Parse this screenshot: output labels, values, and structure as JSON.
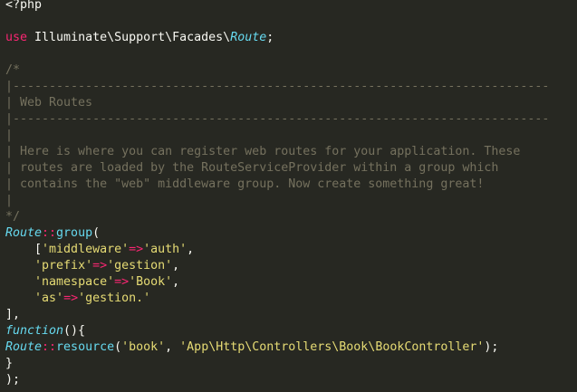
{
  "colors": {
    "background": "#272822",
    "plain": "#f8f8f2",
    "keyword": "#f92672",
    "class": "#66d9ef",
    "string": "#e6db74",
    "comment": "#75715e"
  },
  "code": {
    "lines": [
      [
        {
          "t": "<?php",
          "k": "plain"
        }
      ],
      [],
      [
        {
          "t": "use",
          "k": "keyword"
        },
        {
          "t": " Illuminate\\Support\\Facades\\",
          "k": "plain"
        },
        {
          "t": "Route",
          "k": "class"
        },
        {
          "t": ";",
          "k": "plain"
        }
      ],
      [],
      [
        {
          "t": "/*",
          "k": "comment"
        }
      ],
      [
        {
          "t": "|--------------------------------------------------------------------------",
          "k": "comment"
        }
      ],
      [
        {
          "t": "| Web Routes",
          "k": "comment"
        }
      ],
      [
        {
          "t": "|--------------------------------------------------------------------------",
          "k": "comment"
        }
      ],
      [
        {
          "t": "|",
          "k": "comment"
        }
      ],
      [
        {
          "t": "| Here is where you can register web routes for your application. These",
          "k": "comment"
        }
      ],
      [
        {
          "t": "| routes are loaded by the RouteServiceProvider within a group which",
          "k": "comment"
        }
      ],
      [
        {
          "t": "| contains the \"web\" middleware group. Now create something great!",
          "k": "comment"
        }
      ],
      [
        {
          "t": "|",
          "k": "comment"
        }
      ],
      [
        {
          "t": "*/",
          "k": "comment"
        }
      ],
      [
        {
          "t": "Route",
          "k": "class"
        },
        {
          "t": "::",
          "k": "op"
        },
        {
          "t": "group",
          "k": "method"
        },
        {
          "t": "(",
          "k": "plain"
        }
      ],
      [
        {
          "t": "    [",
          "k": "plain"
        },
        {
          "t": "'middleware'",
          "k": "string"
        },
        {
          "t": "=>",
          "k": "op"
        },
        {
          "t": "'auth'",
          "k": "string"
        },
        {
          "t": ",",
          "k": "plain"
        }
      ],
      [
        {
          "t": "    ",
          "k": "plain"
        },
        {
          "t": "'prefix'",
          "k": "string"
        },
        {
          "t": "=>",
          "k": "op"
        },
        {
          "t": "'gestion'",
          "k": "string"
        },
        {
          "t": ",",
          "k": "plain"
        }
      ],
      [
        {
          "t": "    ",
          "k": "plain"
        },
        {
          "t": "'namespace'",
          "k": "string"
        },
        {
          "t": "=>",
          "k": "op"
        },
        {
          "t": "'Book'",
          "k": "string"
        },
        {
          "t": ",",
          "k": "plain"
        }
      ],
      [
        {
          "t": "    ",
          "k": "plain"
        },
        {
          "t": "'as'",
          "k": "string"
        },
        {
          "t": "=>",
          "k": "op"
        },
        {
          "t": "'gestion.'",
          "k": "string"
        }
      ],
      [
        {
          "t": "],",
          "k": "plain"
        }
      ],
      [
        {
          "t": "function",
          "k": "class"
        },
        {
          "t": "(){",
          "k": "plain"
        }
      ],
      [
        {
          "t": "Route",
          "k": "class"
        },
        {
          "t": "::",
          "k": "op"
        },
        {
          "t": "resource",
          "k": "method"
        },
        {
          "t": "(",
          "k": "plain"
        },
        {
          "t": "'book'",
          "k": "string"
        },
        {
          "t": ", ",
          "k": "plain"
        },
        {
          "t": "'App\\Http\\Controllers\\Book\\BookController'",
          "k": "string"
        },
        {
          "t": ");",
          "k": "plain"
        }
      ],
      [
        {
          "t": "}",
          "k": "plain"
        }
      ],
      [
        {
          "t": ");",
          "k": "plain"
        }
      ]
    ]
  }
}
